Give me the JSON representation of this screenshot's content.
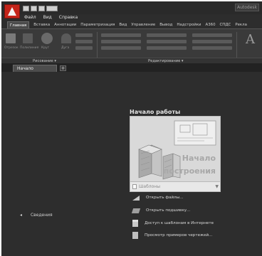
{
  "titlebar": {
    "app_button_icon": "autocad-logo-icon",
    "title": "Autodesk"
  },
  "menu": [
    "Файл",
    "Вид",
    "Справка"
  ],
  "ribbon_tabs": [
    {
      "label": "Главная",
      "active": true
    },
    {
      "label": "Вставка"
    },
    {
      "label": "Аннотации"
    },
    {
      "label": "Параметризация"
    },
    {
      "label": "Вид"
    },
    {
      "label": "Управление"
    },
    {
      "label": "Вывод"
    },
    {
      "label": "Надстройки"
    },
    {
      "label": "A360"
    },
    {
      "label": "СПДС"
    },
    {
      "label": "Рекла"
    }
  ],
  "ribbon": {
    "labels_draw": [
      "Отрезок",
      "Полилиния",
      "Круг",
      "Дуга"
    ],
    "panels": {
      "draw": "Рисование ▾",
      "edit": "Редактирование ▾",
      "last": "A"
    }
  },
  "doc_tabs": {
    "start": "Начало",
    "add": "+"
  },
  "start_panel": {
    "heading": "Начало работы",
    "tile_title_line1": "Начало",
    "tile_title_line2": "построения",
    "templates_label": "Шаблоны",
    "templates_caret": "▼"
  },
  "actions": [
    {
      "label": "Открыть файлы...",
      "icon": "open-folder-icon"
    },
    {
      "label": "Открыть подшивку...",
      "icon": "sheet-set-icon"
    },
    {
      "label": "Доступ к шаблонам в Интернете",
      "icon": "online-templates-icon"
    },
    {
      "label": "Просмотр примеров чертежей...",
      "icon": "sample-drawings-icon"
    }
  ],
  "collapse": {
    "arrow": "◂",
    "label": "Сведения"
  }
}
